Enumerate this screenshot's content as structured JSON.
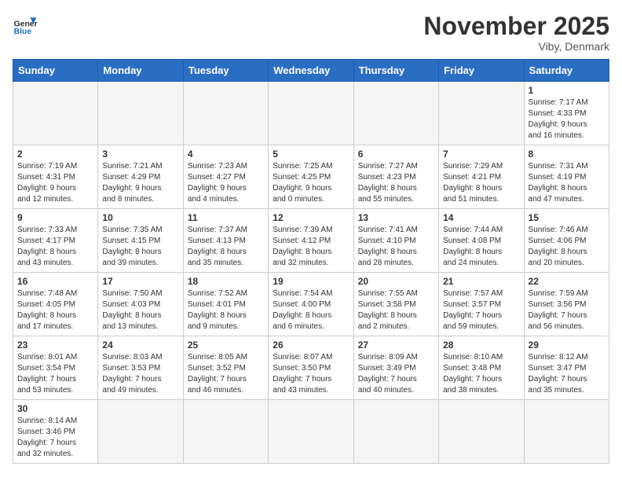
{
  "header": {
    "logo_general": "General",
    "logo_blue": "Blue",
    "month_title": "November 2025",
    "location": "Viby, Denmark"
  },
  "weekdays": [
    "Sunday",
    "Monday",
    "Tuesday",
    "Wednesday",
    "Thursday",
    "Friday",
    "Saturday"
  ],
  "weeks": [
    [
      {
        "day": "",
        "info": ""
      },
      {
        "day": "",
        "info": ""
      },
      {
        "day": "",
        "info": ""
      },
      {
        "day": "",
        "info": ""
      },
      {
        "day": "",
        "info": ""
      },
      {
        "day": "",
        "info": ""
      },
      {
        "day": "1",
        "info": "Sunrise: 7:17 AM\nSunset: 4:33 PM\nDaylight: 9 hours\nand 16 minutes."
      }
    ],
    [
      {
        "day": "2",
        "info": "Sunrise: 7:19 AM\nSunset: 4:31 PM\nDaylight: 9 hours\nand 12 minutes."
      },
      {
        "day": "3",
        "info": "Sunrise: 7:21 AM\nSunset: 4:29 PM\nDaylight: 9 hours\nand 8 minutes."
      },
      {
        "day": "4",
        "info": "Sunrise: 7:23 AM\nSunset: 4:27 PM\nDaylight: 9 hours\nand 4 minutes."
      },
      {
        "day": "5",
        "info": "Sunrise: 7:25 AM\nSunset: 4:25 PM\nDaylight: 9 hours\nand 0 minutes."
      },
      {
        "day": "6",
        "info": "Sunrise: 7:27 AM\nSunset: 4:23 PM\nDaylight: 8 hours\nand 55 minutes."
      },
      {
        "day": "7",
        "info": "Sunrise: 7:29 AM\nSunset: 4:21 PM\nDaylight: 8 hours\nand 51 minutes."
      },
      {
        "day": "8",
        "info": "Sunrise: 7:31 AM\nSunset: 4:19 PM\nDaylight: 8 hours\nand 47 minutes."
      }
    ],
    [
      {
        "day": "9",
        "info": "Sunrise: 7:33 AM\nSunset: 4:17 PM\nDaylight: 8 hours\nand 43 minutes."
      },
      {
        "day": "10",
        "info": "Sunrise: 7:35 AM\nSunset: 4:15 PM\nDaylight: 8 hours\nand 39 minutes."
      },
      {
        "day": "11",
        "info": "Sunrise: 7:37 AM\nSunset: 4:13 PM\nDaylight: 8 hours\nand 35 minutes."
      },
      {
        "day": "12",
        "info": "Sunrise: 7:39 AM\nSunset: 4:12 PM\nDaylight: 8 hours\nand 32 minutes."
      },
      {
        "day": "13",
        "info": "Sunrise: 7:41 AM\nSunset: 4:10 PM\nDaylight: 8 hours\nand 28 minutes."
      },
      {
        "day": "14",
        "info": "Sunrise: 7:44 AM\nSunset: 4:08 PM\nDaylight: 8 hours\nand 24 minutes."
      },
      {
        "day": "15",
        "info": "Sunrise: 7:46 AM\nSunset: 4:06 PM\nDaylight: 8 hours\nand 20 minutes."
      }
    ],
    [
      {
        "day": "16",
        "info": "Sunrise: 7:48 AM\nSunset: 4:05 PM\nDaylight: 8 hours\nand 17 minutes."
      },
      {
        "day": "17",
        "info": "Sunrise: 7:50 AM\nSunset: 4:03 PM\nDaylight: 8 hours\nand 13 minutes."
      },
      {
        "day": "18",
        "info": "Sunrise: 7:52 AM\nSunset: 4:01 PM\nDaylight: 8 hours\nand 9 minutes."
      },
      {
        "day": "19",
        "info": "Sunrise: 7:54 AM\nSunset: 4:00 PM\nDaylight: 8 hours\nand 6 minutes."
      },
      {
        "day": "20",
        "info": "Sunrise: 7:55 AM\nSunset: 3:58 PM\nDaylight: 8 hours\nand 2 minutes."
      },
      {
        "day": "21",
        "info": "Sunrise: 7:57 AM\nSunset: 3:57 PM\nDaylight: 7 hours\nand 59 minutes."
      },
      {
        "day": "22",
        "info": "Sunrise: 7:59 AM\nSunset: 3:56 PM\nDaylight: 7 hours\nand 56 minutes."
      }
    ],
    [
      {
        "day": "23",
        "info": "Sunrise: 8:01 AM\nSunset: 3:54 PM\nDaylight: 7 hours\nand 53 minutes."
      },
      {
        "day": "24",
        "info": "Sunrise: 8:03 AM\nSunset: 3:53 PM\nDaylight: 7 hours\nand 49 minutes."
      },
      {
        "day": "25",
        "info": "Sunrise: 8:05 AM\nSunset: 3:52 PM\nDaylight: 7 hours\nand 46 minutes."
      },
      {
        "day": "26",
        "info": "Sunrise: 8:07 AM\nSunset: 3:50 PM\nDaylight: 7 hours\nand 43 minutes."
      },
      {
        "day": "27",
        "info": "Sunrise: 8:09 AM\nSunset: 3:49 PM\nDaylight: 7 hours\nand 40 minutes."
      },
      {
        "day": "28",
        "info": "Sunrise: 8:10 AM\nSunset: 3:48 PM\nDaylight: 7 hours\nand 38 minutes."
      },
      {
        "day": "29",
        "info": "Sunrise: 8:12 AM\nSunset: 3:47 PM\nDaylight: 7 hours\nand 35 minutes."
      }
    ],
    [
      {
        "day": "30",
        "info": "Sunrise: 8:14 AM\nSunset: 3:46 PM\nDaylight: 7 hours\nand 32 minutes."
      },
      {
        "day": "",
        "info": ""
      },
      {
        "day": "",
        "info": ""
      },
      {
        "day": "",
        "info": ""
      },
      {
        "day": "",
        "info": ""
      },
      {
        "day": "",
        "info": ""
      },
      {
        "day": "",
        "info": ""
      }
    ]
  ]
}
